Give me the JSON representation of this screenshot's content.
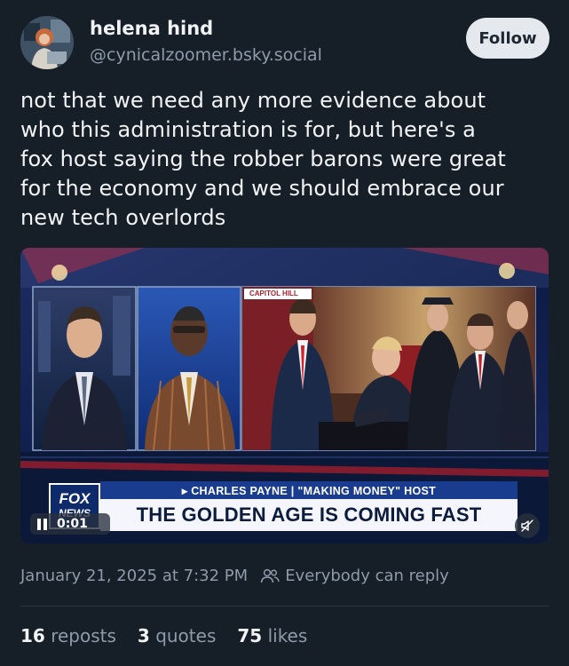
{
  "author": {
    "name": "helena hind",
    "handle": "@cynicalzoomer.bsky.social"
  },
  "follow_label": "Follow",
  "post": {
    "text": "not that we need any more evidence about\nwho this administration is for, but here's a\nfox host saying the robber barons were great\nfor the economy and we should embrace our\nnew tech overlords"
  },
  "video": {
    "chyron_top": "▸ CHARLES PAYNE | \"MAKING MONEY\" HOST",
    "chyron_main": "THE GOLDEN AGE IS COMING FAST",
    "inset_label": "CAPITOL HILL",
    "logo_line1": "FOX",
    "logo_line2": "NEWS",
    "time": "0:01",
    "pause_icon": "pause-icon",
    "mute_icon": "muted-speaker-icon"
  },
  "meta": {
    "timestamp": "January 21, 2025 at 7:32 PM",
    "reply_setting": "Everybody can reply",
    "reply_icon": "people-icon"
  },
  "stats": {
    "reposts_count": "16",
    "reposts_label": "reposts",
    "quotes_count": "3",
    "quotes_label": "quotes",
    "likes_count": "75",
    "likes_label": "likes"
  },
  "colors": {
    "background": "#161e27",
    "text": "#f1f3f5",
    "muted": "#8d9bab",
    "follow_bg": "#e5e9ee",
    "chyron_blue": "#1a3c8f"
  }
}
